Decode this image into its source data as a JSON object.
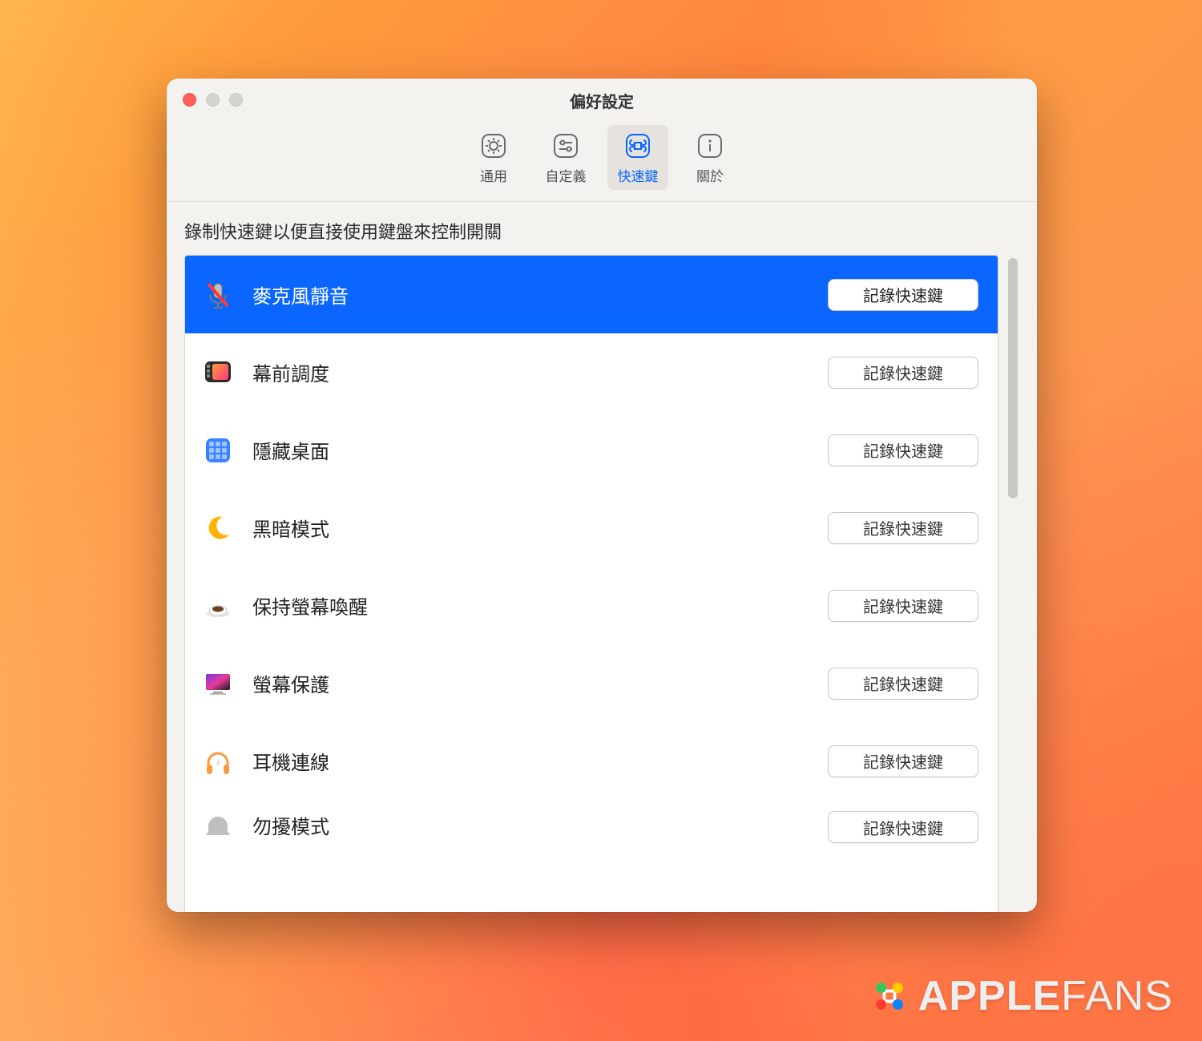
{
  "window": {
    "title": "偏好設定"
  },
  "toolbar": {
    "items": [
      {
        "label": "通用",
        "icon": "gear"
      },
      {
        "label": "自定義",
        "icon": "sliders"
      },
      {
        "label": "快速鍵",
        "icon": "command"
      },
      {
        "label": "關於",
        "icon": "info"
      }
    ],
    "active_index": 2
  },
  "instruction": "錄制快速鍵以便直接使用鍵盤來控制開關",
  "record_button_label": "記錄快速鍵",
  "rows": [
    {
      "label": "麥克風靜音",
      "icon": "mic-mute",
      "selected": true
    },
    {
      "label": "幕前調度",
      "icon": "stage-manager",
      "selected": false
    },
    {
      "label": "隱藏桌面",
      "icon": "desktop-grid",
      "selected": false
    },
    {
      "label": "黑暗模式",
      "icon": "moon",
      "selected": false
    },
    {
      "label": "保持螢幕喚醒",
      "icon": "coffee",
      "selected": false
    },
    {
      "label": "螢幕保護",
      "icon": "screensaver",
      "selected": false
    },
    {
      "label": "耳機連線",
      "icon": "headphones",
      "selected": false
    },
    {
      "label": "勿擾模式",
      "icon": "dnd",
      "selected": false
    }
  ],
  "watermark": {
    "brand_bold": "APPLE",
    "brand_thin": "FANS"
  }
}
